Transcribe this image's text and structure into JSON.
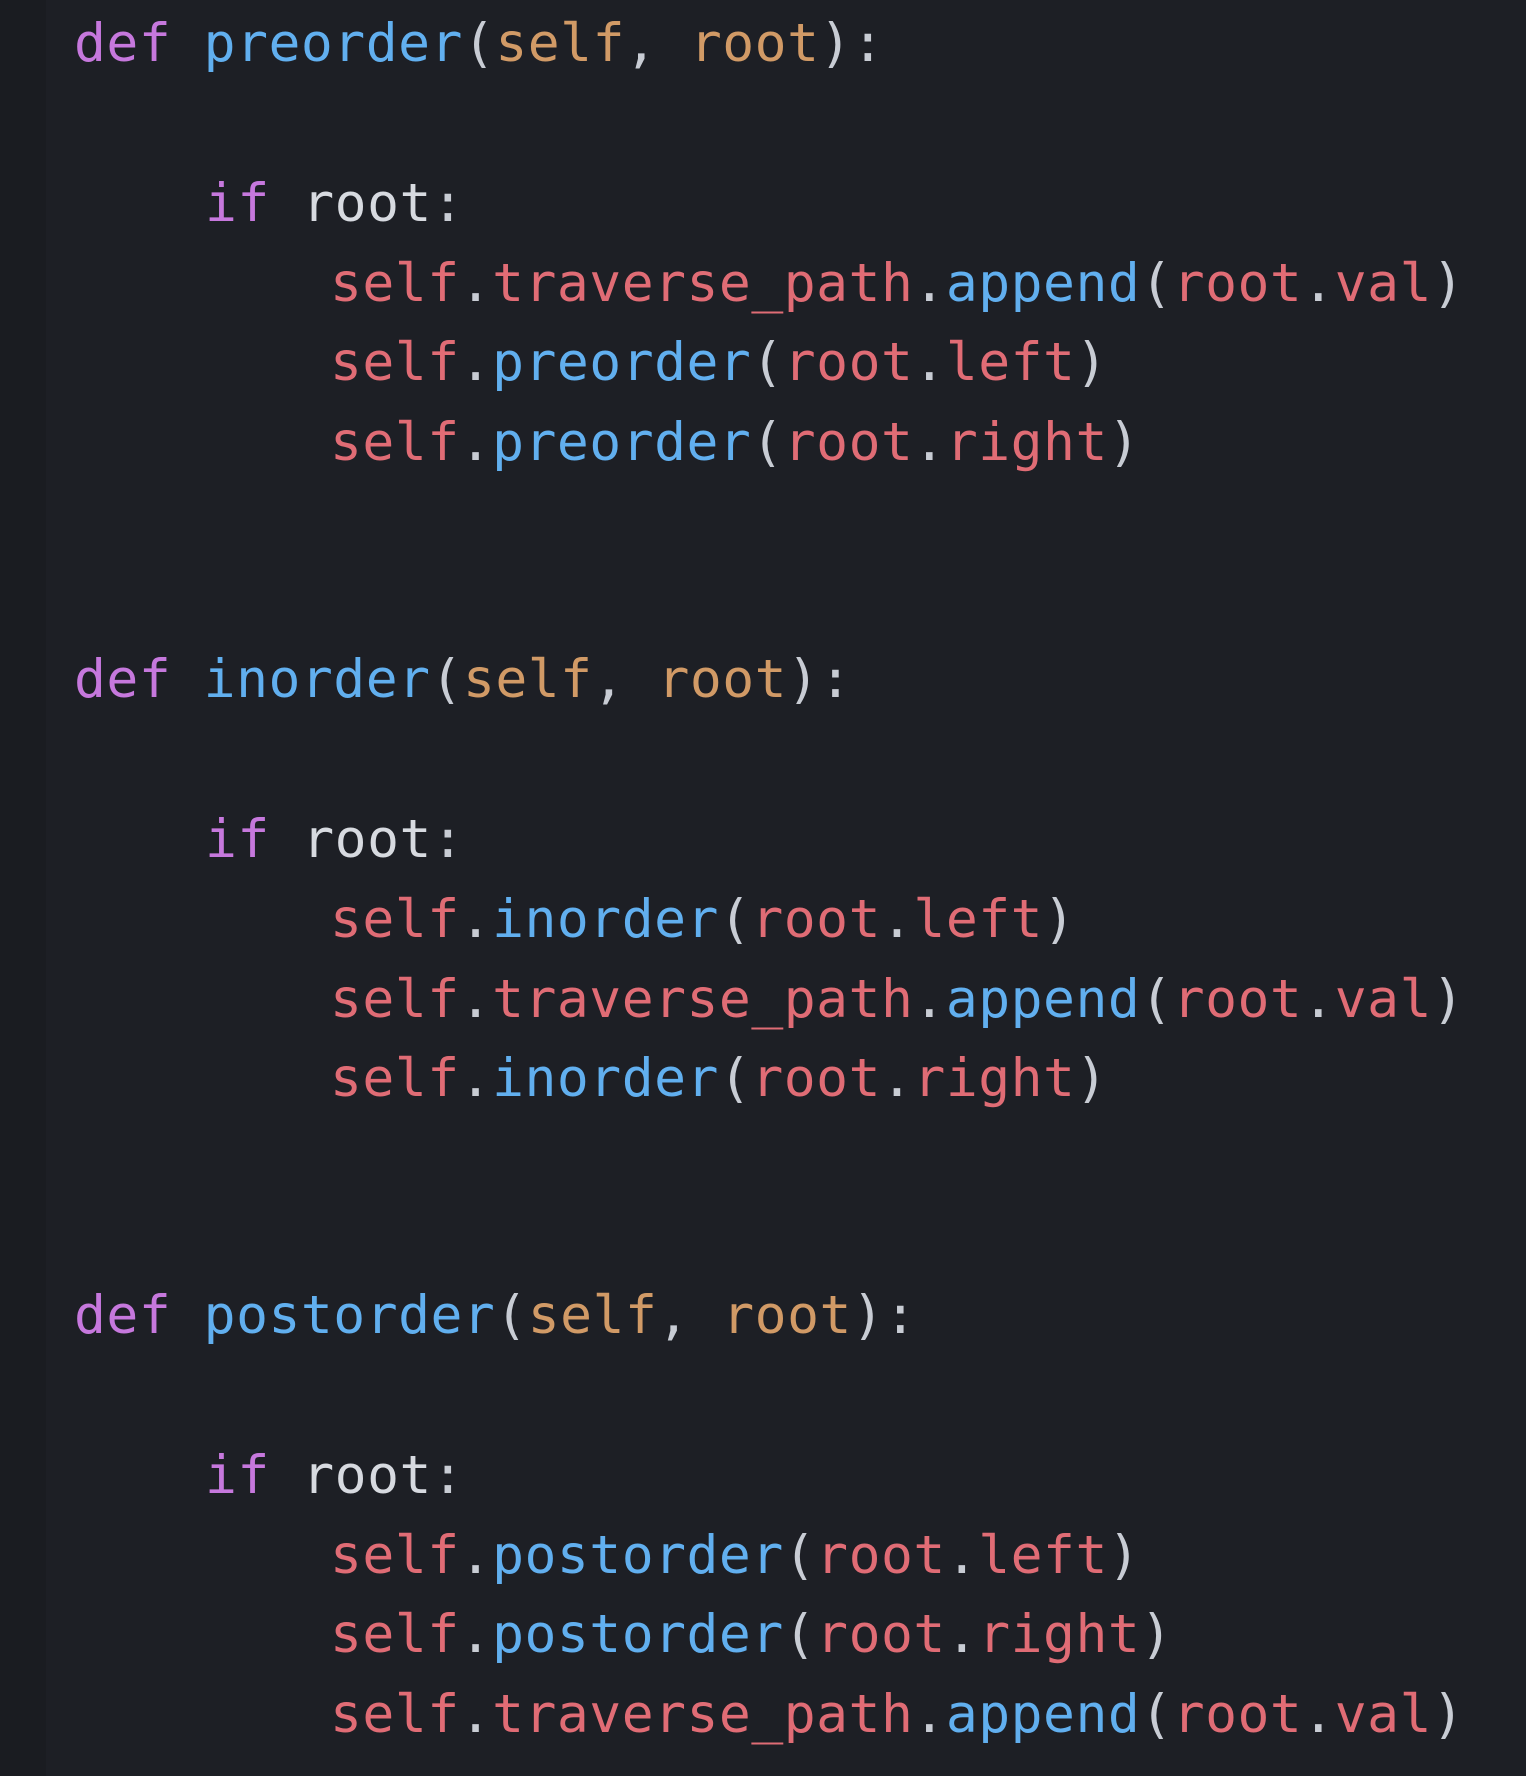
{
  "colors": {
    "background": "#1d1f25",
    "keyword": "#c678dd",
    "function": "#61afef",
    "parameter": "#d19a66",
    "self_and_attribute": "#e06c75",
    "plain": "#d7dae0"
  },
  "code": {
    "kw_def": "def",
    "kw_if": "if",
    "self": "self",
    "root": "root",
    "comma": ",",
    "open_paren": "(",
    "close_paren": ")",
    "colon": ":",
    "dot": ".",
    "traverse_path": "traverse_path",
    "append": "append",
    "val": "val",
    "left": "left",
    "right": "right",
    "fn_preorder": "preorder",
    "fn_inorder": "inorder",
    "fn_postorder": "postorder"
  }
}
